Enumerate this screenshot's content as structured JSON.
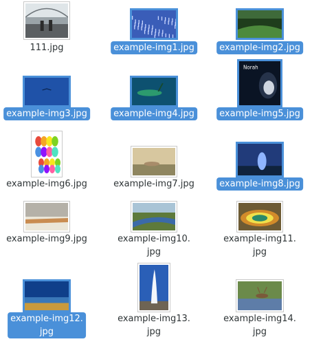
{
  "selection_color": "#4a90d9",
  "files": [
    {
      "name": "111.jpg",
      "selected": false,
      "icon": "image-thumbnail-hall"
    },
    {
      "name": "example-img1.jpg",
      "selected": true,
      "icon": "image-thumbnail-flamingos"
    },
    {
      "name": "example-img2.jpg",
      "selected": true,
      "icon": "image-thumbnail-valley"
    },
    {
      "name": "example-img3.jpg",
      "selected": true,
      "icon": "image-thumbnail-bird-blue"
    },
    {
      "name": "example-img4.jpg",
      "selected": true,
      "icon": "image-thumbnail-leaf"
    },
    {
      "name": "example-img5.jpg",
      "selected": true,
      "icon": "image-thumbnail-album-cover"
    },
    {
      "name": "example-img6.jpg",
      "selected": false,
      "icon": "image-thumbnail-color-pattern"
    },
    {
      "name": "example-img7.jpg",
      "selected": false,
      "icon": "image-thumbnail-deer"
    },
    {
      "name": "example-img8.jpg",
      "selected": true,
      "icon": "image-thumbnail-geyser-night"
    },
    {
      "name": "example-img9.jpg",
      "selected": false,
      "icon": "image-thumbnail-terraces"
    },
    {
      "name": "example-img10.\njpg",
      "selected": false,
      "icon": "image-thumbnail-river"
    },
    {
      "name": "example-img11.\njpg",
      "selected": false,
      "icon": "image-thumbnail-hot-spring"
    },
    {
      "name": "example-img12.\njpg",
      "selected": true,
      "icon": "image-thumbnail-lake"
    },
    {
      "name": "example-img13.\njpg",
      "selected": false,
      "icon": "image-thumbnail-geyser"
    },
    {
      "name": "example-img14.\njpg",
      "selected": false,
      "icon": "image-thumbnail-elk"
    }
  ]
}
